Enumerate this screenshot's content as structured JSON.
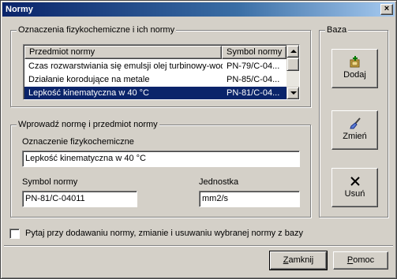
{
  "window": {
    "title": "Normy",
    "close_glyph": "×"
  },
  "group_norms": {
    "legend": "Oznaczenia fizykochemiczne i ich normy",
    "columns": [
      "Przedmiot normy",
      "Symbol normy"
    ],
    "rows": [
      {
        "subject": "Czas rozwarstwiania się emulsji olej turbinowy-woda",
        "symbol": "PN-79/C-04...",
        "selected": false
      },
      {
        "subject": "Działanie korodujące na metale",
        "symbol": "PN-85/C-04...",
        "selected": false
      },
      {
        "subject": "Lepkość kinematyczna w 40 °C",
        "symbol": "PN-81/C-04...",
        "selected": true
      }
    ]
  },
  "group_input": {
    "legend": "Wprowadź normę i przedmiot normy",
    "designation_label": "Oznaczenie fizykochemiczne",
    "designation_value": "Lepkość kinematyczna w 40 °C",
    "symbol_label": "Symbol normy",
    "symbol_value": "PN-81/C-04011",
    "unit_label": "Jednostka",
    "unit_value": "mm2/s"
  },
  "group_base": {
    "legend": "Baza",
    "add_label": "Dodaj",
    "add_icon": "add-record-icon",
    "edit_label": "Zmień",
    "edit_icon": "brush-icon",
    "delete_label": "Usuń",
    "delete_icon": "x-delete-icon"
  },
  "confirm_checkbox": {
    "label": "Pytaj przy dodawaniu normy, zmianie i usuwaniu wybranej normy z bazy",
    "checked": false
  },
  "footer": {
    "close_hotkey": "Z",
    "close_rest": "amknij",
    "help_hotkey": "P",
    "help_rest": "omoc"
  },
  "colors": {
    "face": "#d4d0c8",
    "titlebar": "#0a246a",
    "selection": "#0a246a"
  }
}
